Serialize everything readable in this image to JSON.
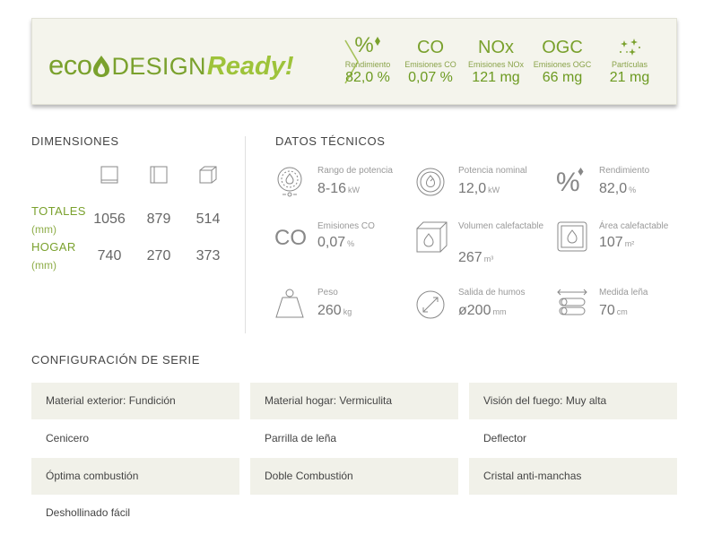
{
  "banner": {
    "logo": {
      "eco": "eco",
      "design": "DESIGN",
      "ready": "Ready!"
    },
    "stats": [
      {
        "symbol": "%",
        "label": "Rendimiento",
        "value": "82,0",
        "unit": "%"
      },
      {
        "symbol": "CO",
        "label": "Emisiones CO",
        "value": "0,07",
        "unit": "%"
      },
      {
        "symbol": "NOx",
        "label": "Emisiones NOx",
        "value": "121",
        "unit": "mg"
      },
      {
        "symbol": "OGC",
        "label": "Emisiones OGC",
        "value": "66",
        "unit": "mg"
      },
      {
        "symbol": "",
        "label": "Partículas",
        "value": "21",
        "unit": "mg"
      }
    ]
  },
  "dimensiones": {
    "title": "DIMENSIONES",
    "icons": [
      "front-view-icon",
      "side-view-icon",
      "depth-view-icon"
    ],
    "rows": [
      {
        "label": "TOTALES",
        "unit": "(mm)",
        "values": [
          "1056",
          "879",
          "514"
        ]
      },
      {
        "label": "HOGAR",
        "unit": "(mm)",
        "values": [
          "740",
          "270",
          "373"
        ]
      }
    ]
  },
  "datos": {
    "title": "DATOS TÉCNICOS",
    "items": [
      {
        "icon": "power-range-icon",
        "label": "Rango de potencia",
        "value": "8-16",
        "unit": "kW"
      },
      {
        "icon": "nominal-power-icon",
        "label": "Potencia nominal",
        "value": "12,0",
        "unit": "kW"
      },
      {
        "icon": "efficiency-icon",
        "label": "Rendimiento",
        "value": "82,0",
        "unit": "%"
      },
      {
        "icon": "co-emissions-icon",
        "label": "Emisiones CO",
        "value": "0,07",
        "unit": "%"
      },
      {
        "icon": "heating-volume-icon",
        "label": "Volumen calefactable",
        "value": "267",
        "unit": "m³"
      },
      {
        "icon": "heating-area-icon",
        "label": "Área calefactable",
        "value": "107",
        "unit": "m²"
      },
      {
        "icon": "weight-icon",
        "label": "Peso",
        "value": "260",
        "unit": "kg"
      },
      {
        "icon": "flue-outlet-icon",
        "label": "Salida de humos",
        "value": "ø200",
        "unit": "mm"
      },
      {
        "icon": "firewood-icon",
        "label": "Medida leña",
        "value": "70",
        "unit": "cm"
      }
    ],
    "co_symbol": "CO",
    "pct_symbol": "%"
  },
  "configuracion": {
    "title": "CONFIGURACIÓN DE SERIE",
    "items": [
      "Material exterior: Fundición",
      "Material hogar: Vermiculita",
      "Visión del fuego: Muy alta",
      "Cenicero",
      "Parrilla de leña",
      "Deflector",
      "Óptima combustión",
      "Doble Combustión",
      "Cristal anti-manchas",
      "Deshollinado fácil"
    ]
  },
  "colors": {
    "accent": "#7aa12d",
    "accent_light": "#9ec33a",
    "row_shade": "#f1f1e9"
  }
}
